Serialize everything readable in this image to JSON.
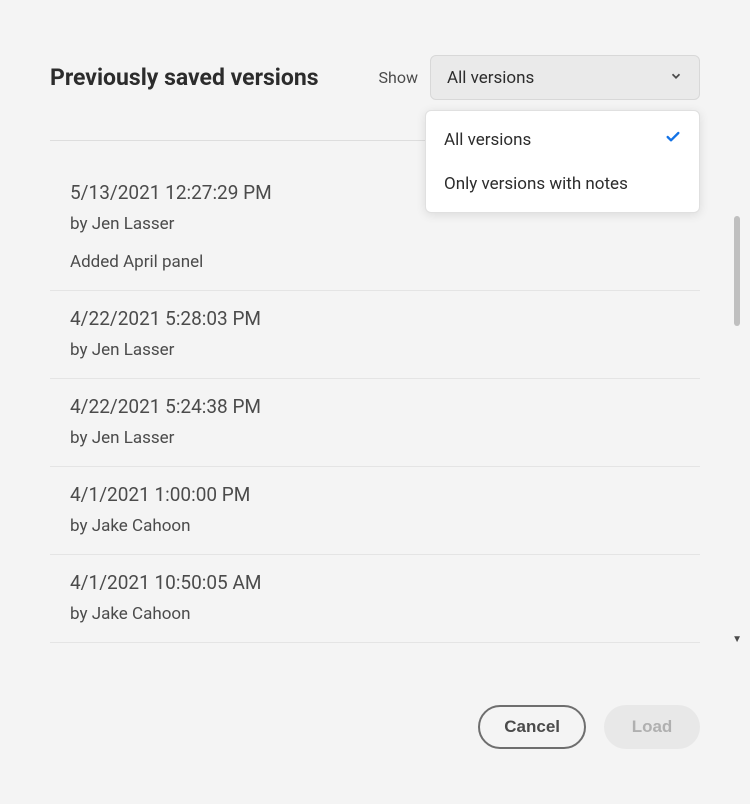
{
  "header": {
    "title": "Previously saved versions",
    "show_label": "Show",
    "selected_filter": "All versions"
  },
  "dropdown": {
    "options": [
      {
        "label": "All versions",
        "selected": true
      },
      {
        "label": "Only versions with notes",
        "selected": false
      }
    ]
  },
  "versions": [
    {
      "timestamp": "5/13/2021 12:27:29 PM",
      "author": "by Jen Lasser",
      "note": "Added April panel"
    },
    {
      "timestamp": "4/22/2021 5:28:03 PM",
      "author": "by Jen Lasser",
      "note": ""
    },
    {
      "timestamp": "4/22/2021 5:24:38 PM",
      "author": "by Jen Lasser",
      "note": ""
    },
    {
      "timestamp": "4/1/2021 1:00:00 PM",
      "author": "by Jake Cahoon",
      "note": ""
    },
    {
      "timestamp": "4/1/2021 10:50:05 AM",
      "author": "by Jake Cahoon",
      "note": ""
    }
  ],
  "footer": {
    "cancel_label": "Cancel",
    "load_label": "Load"
  }
}
